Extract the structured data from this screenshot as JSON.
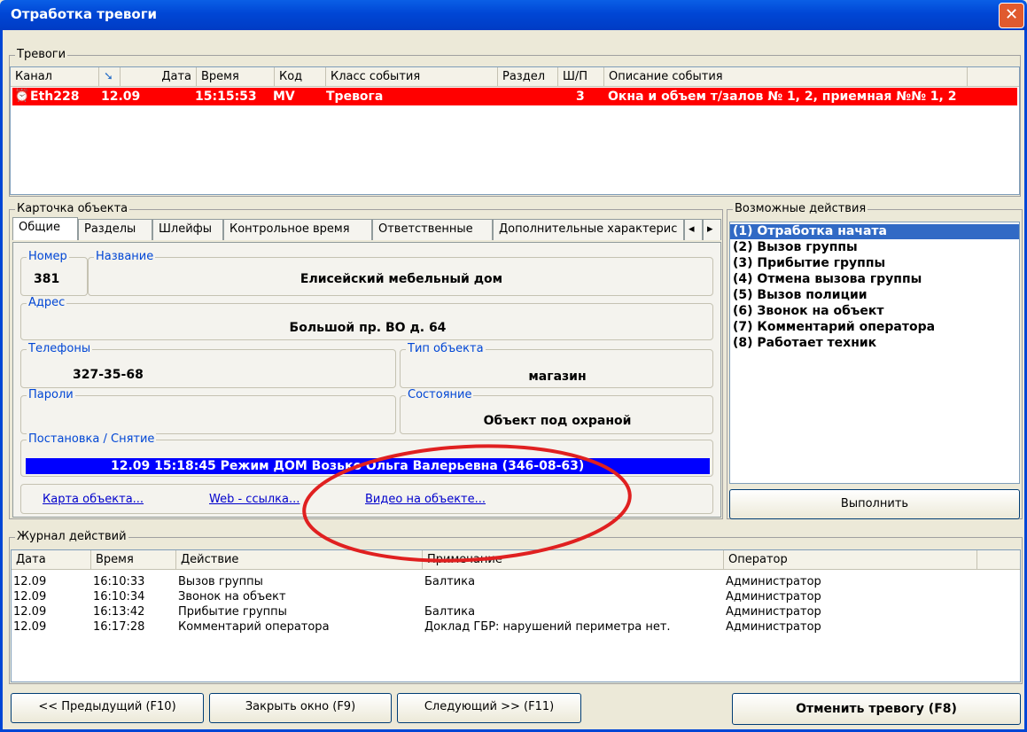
{
  "window": {
    "title": "Отработка тревоги",
    "close_glyph": "✕"
  },
  "alarms": {
    "group_label": "Тревоги",
    "columns": [
      "Канал",
      "Дата",
      "Время",
      "Код",
      "Класс события",
      "Раздел",
      "Ш/П",
      "Описание события"
    ],
    "row": {
      "channel": "Eth228",
      "date": "12.09",
      "time": "15:15:53",
      "code": "MV",
      "event_class": "Тревога",
      "section": "",
      "loop": "3",
      "description": "Окна и объем т/залов № 1, 2, приемная №№ 1, 2"
    }
  },
  "card": {
    "group_label": "Карточка объекта",
    "tabs": [
      "Общие",
      "Разделы",
      "Шлейфы",
      "Контрольное время",
      "Ответственные",
      "Дополнительные характерис"
    ],
    "fields": {
      "number_label": "Номер",
      "number": "381",
      "name_label": "Название",
      "name": "Елисейский мебельный дом",
      "address_label": "Адрес",
      "address": "Большой пр. ВО д. 64",
      "phones_label": "Телефоны",
      "phones": "327-35-68",
      "type_label": "Тип объекта",
      "type": "магазин",
      "passwords_label": "Пароли",
      "passwords": "",
      "state_label": "Состояние",
      "state": "Объект под охраной",
      "arm_label": "Постановка / Снятие",
      "arm_value": "12.09  15:18:45  Режим ДОМ  Возько Ольга Валерьевна (346-08-63)"
    },
    "links": {
      "map": "Карта объекта...",
      "web": "Web - ссылка...",
      "video": "Видео на объекте..."
    }
  },
  "actions": {
    "group_label": "Возможные действия",
    "items": [
      "(1) Отработка начата",
      "(2) Вызов группы",
      "(3) Прибытие группы",
      "(4) Отмена вызова группы",
      "(5) Вызов полиции",
      "(6) Звонок на объект",
      "(7) Комментарий оператора",
      "(8) Работает техник"
    ],
    "execute": "Выполнить",
    "selected_color": "#316ac5"
  },
  "log": {
    "group_label": "Журнал действий",
    "columns": [
      "Дата",
      "Время",
      "Действие",
      "Примечание",
      "Оператор"
    ],
    "rows": [
      {
        "date": "12.09",
        "time": "16:10:33",
        "action": "Вызов группы",
        "note": "Балтика",
        "operator": "Администратор"
      },
      {
        "date": "12.09",
        "time": "16:10:34",
        "action": "Звонок на объект",
        "note": "",
        "operator": "Администратор"
      },
      {
        "date": "12.09",
        "time": "16:13:42",
        "action": "Прибытие группы",
        "note": "Балтика",
        "operator": "Администратор"
      },
      {
        "date": "12.09",
        "time": "16:17:28",
        "action": "Комментарий оператора",
        "note": "Доклад ГБР: нарушений периметра нет.",
        "operator": "Администратор"
      }
    ]
  },
  "footer": {
    "prev": "<< Предыдущий (F10)",
    "close": "Закрыть окно (F9)",
    "next": "Следующий >> (F11)",
    "cancel_alarm": "Отменить тревогу (F8)"
  },
  "colors": {
    "alarm_row": "#ff0000",
    "arm_bar": "#0000ff",
    "annotation": "#e02020"
  }
}
